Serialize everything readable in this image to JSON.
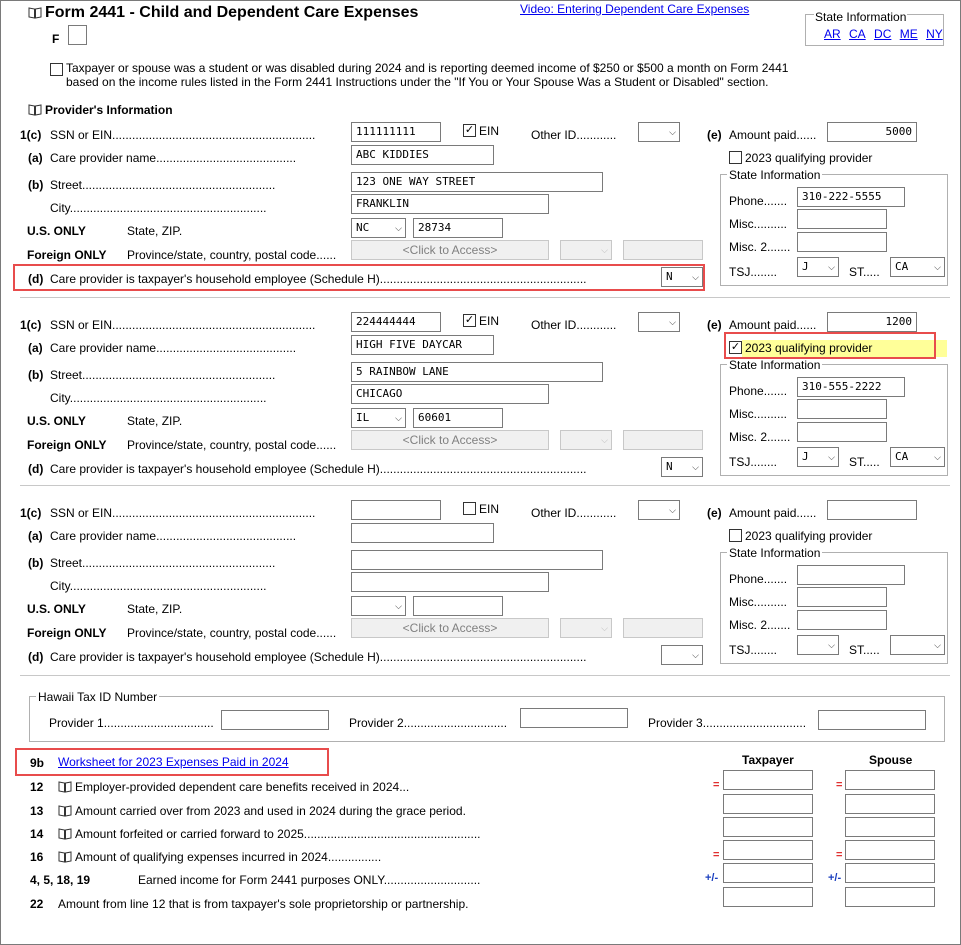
{
  "header": {
    "title": "Form 2441 - Child and Dependent Care Expenses",
    "video_link": "Video: Entering Dependent Care Expenses",
    "f_label": "F",
    "state_info_title": "State Information",
    "states": [
      "AR",
      "CA",
      "DC",
      "ME",
      "NY"
    ]
  },
  "student_note": {
    "line1": "Taxpayer or spouse was a student or was disabled during 2024 and is reporting deemed income of $250 or $500 a month on Form 2441",
    "line2": "based on the income rules listed in the Form 2441 Instructions under the \"If You or Your Spouse Was a Student or Disabled\" section."
  },
  "provider_section_title": "Provider's Information",
  "labels": {
    "line_1c": "1(c)",
    "ssn_ein": "SSN or EIN",
    "ein": "EIN",
    "other_id": "Other ID",
    "line_e": "(e)",
    "amount_paid": "Amount paid",
    "line_a": "(a)",
    "care_provider_name": "Care provider name",
    "qualifying_provider": "2023 qualifying provider",
    "line_b": "(b)",
    "street": "Street",
    "state_information": "State Information",
    "city": "City",
    "phone": "Phone",
    "us_only": "U.S. ONLY",
    "state_zip": "State, ZIP",
    "misc": "Misc.",
    "foreign_only": "Foreign ONLY",
    "province": "Province/state, country, postal code",
    "misc2": "Misc. 2",
    "line_d": "(d)",
    "household_employee": "Care provider is taxpayer's household employee (Schedule H)",
    "tsj": "TSJ",
    "st": "ST",
    "click_to_access": "<Click to Access>"
  },
  "providers": [
    {
      "ssn": "111111111",
      "ein_checked": true,
      "ein_mark": "✓",
      "other_id": "",
      "amount": "5000",
      "name": "ABC KIDDIES",
      "qualifying_checked": false,
      "qualifying_mark": "",
      "street": "123 ONE WAY STREET",
      "city": "FRANKLIN",
      "state": "NC",
      "zip": "28734",
      "phone": "310-222-5555",
      "misc": "",
      "misc2": "",
      "household": "N",
      "tsj": "J",
      "st": "CA"
    },
    {
      "ssn": "224444444",
      "ein_checked": true,
      "ein_mark": "✓",
      "other_id": "",
      "amount": "1200",
      "name": "HIGH FIVE DAYCAR",
      "qualifying_checked": true,
      "qualifying_mark": "✓",
      "street": "5 RAINBOW LANE",
      "city": "CHICAGO",
      "state": "IL",
      "zip": "60601",
      "phone": "310-555-2222",
      "misc": "",
      "misc2": "",
      "household": "N",
      "tsj": "J",
      "st": "CA"
    },
    {
      "ssn": "",
      "ein_checked": false,
      "ein_mark": "",
      "other_id": "",
      "amount": "",
      "name": "",
      "qualifying_checked": false,
      "qualifying_mark": "",
      "street": "",
      "city": "",
      "state": "",
      "zip": "",
      "phone": "",
      "misc": "",
      "misc2": "",
      "household": "",
      "tsj": "",
      "st": ""
    }
  ],
  "hawaii": {
    "title": "Hawaii Tax ID Number",
    "provider1": "Provider 1",
    "provider2": "Provider 2",
    "provider3": "Provider 3"
  },
  "worksheet": {
    "line": "9b",
    "link": "Worksheet for 2023 Expenses Paid in 2024",
    "taxpayer_header": "Taxpayer",
    "spouse_header": "Spouse"
  },
  "lines": [
    {
      "num": "12",
      "book": true,
      "text": "Employer-provided dependent care benefits received in 2024",
      "sign": "=",
      "sign_color": "red"
    },
    {
      "num": "13",
      "book": true,
      "text": "Amount carried over from 2023 and used in 2024 during the grace period",
      "sign": "",
      "sign_color": ""
    },
    {
      "num": "14",
      "book": true,
      "text": "Amount forfeited or carried forward to 2025",
      "sign": "",
      "sign_color": ""
    },
    {
      "num": "16",
      "book": true,
      "text": "Amount of qualifying expenses incurred in 2024",
      "sign": "=",
      "sign_color": "red"
    },
    {
      "num": "4, 5, 18, 19",
      "book": false,
      "text": "Earned income for Form 2441 purposes ONLY",
      "sign": "+/-",
      "sign_color": "blue"
    },
    {
      "num": "22",
      "book": false,
      "text": "Amount from line 12 that is from taxpayer's sole proprietorship or partnership",
      "sign": "",
      "sign_color": ""
    }
  ]
}
